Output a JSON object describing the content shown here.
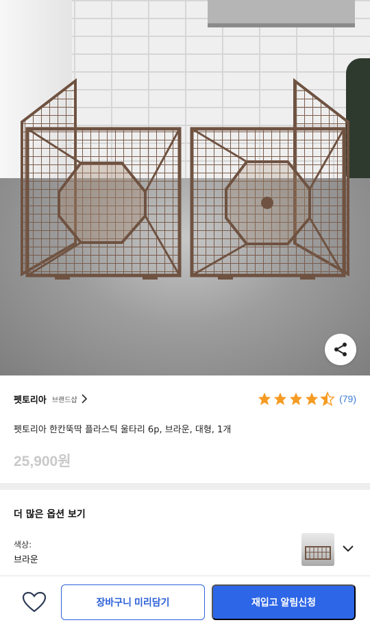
{
  "product": {
    "image_alt": "pet fence product photo",
    "brand": "펫토리아",
    "brand_shop_label": "브랜드샵",
    "rating": 4.5,
    "review_count": "(79)",
    "title": "펫토리아 한칸뚝딱 플라스틱 울타리 6p, 브라운, 대형, 1개",
    "price": "25,900원"
  },
  "options": {
    "heading": "더 많은 옵션 보기",
    "color_label": "색상:",
    "color_value": "브라운"
  },
  "actions": {
    "cart_label": "장바구니 미리담기",
    "restock_label": "재입고 알림신청"
  },
  "colors": {
    "accent": "#2d66e6",
    "star": "#f59b23",
    "review_link": "#3a7bd5",
    "fence": "#7a5c4a"
  },
  "icons": [
    "share-icon",
    "chevron-right-icon",
    "star-icon",
    "chevron-down-icon",
    "heart-icon"
  ]
}
